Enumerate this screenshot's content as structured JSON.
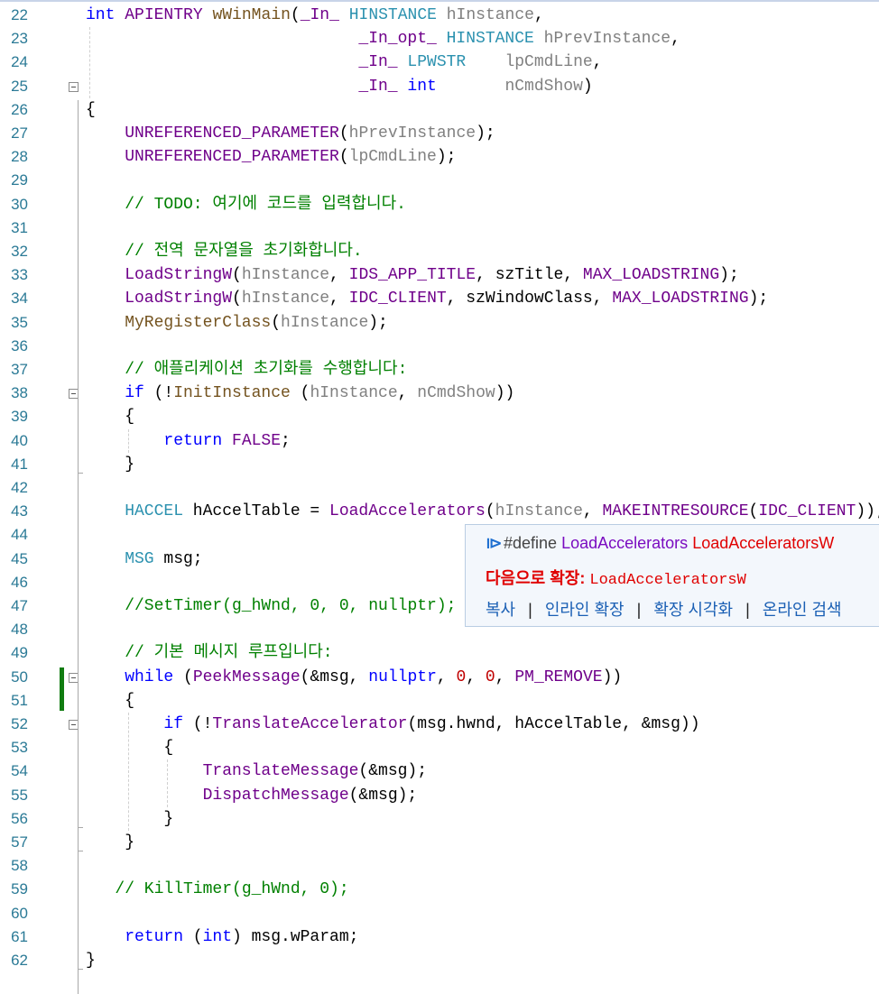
{
  "editor": {
    "lines": [
      {
        "n": "22",
        "indent": 0,
        "tokens": [
          [
            "int",
            "kw"
          ],
          [
            " "
          ],
          [
            "APIENTRY",
            "mac"
          ],
          [
            " "
          ],
          [
            "wWinMain",
            "fn"
          ],
          [
            "("
          ],
          [
            "_In_",
            "mac"
          ],
          [
            " "
          ],
          [
            "HINSTANCE",
            "type"
          ],
          [
            " "
          ],
          [
            "hInstance",
            "param"
          ],
          [
            ","
          ]
        ]
      },
      {
        "n": "23",
        "indent": 14,
        "tokens": [
          [
            "_In_opt_",
            "mac"
          ],
          [
            " "
          ],
          [
            "HINSTANCE",
            "type"
          ],
          [
            " "
          ],
          [
            "hPrevInstance",
            "param"
          ],
          [
            ","
          ]
        ]
      },
      {
        "n": "24",
        "indent": 14,
        "tokens": [
          [
            "_In_",
            "mac"
          ],
          [
            " "
          ],
          [
            "LPWSTR",
            "type"
          ],
          [
            "    "
          ],
          [
            "lpCmdLine",
            "param"
          ],
          [
            ","
          ]
        ]
      },
      {
        "n": "25",
        "indent": 14,
        "tokens": [
          [
            "_In_",
            "mac"
          ],
          [
            " "
          ],
          [
            "int",
            "kw"
          ],
          [
            "       "
          ],
          [
            "nCmdShow",
            "param"
          ],
          [
            ")"
          ]
        ]
      },
      {
        "n": "26",
        "indent": 0,
        "tokens": [
          [
            "{"
          ]
        ]
      },
      {
        "n": "27",
        "indent": 2,
        "tokens": [
          [
            "UNREFERENCED_PARAMETER",
            "mac"
          ],
          [
            "("
          ],
          [
            "hPrevInstance",
            "param"
          ],
          [
            ");"
          ]
        ]
      },
      {
        "n": "28",
        "indent": 2,
        "tokens": [
          [
            "UNREFERENCED_PARAMETER",
            "mac"
          ],
          [
            "("
          ],
          [
            "lpCmdLine",
            "param"
          ],
          [
            ");"
          ]
        ]
      },
      {
        "n": "29",
        "indent": 0,
        "tokens": []
      },
      {
        "n": "30",
        "indent": 2,
        "tokens": [
          [
            "// TODO: 여기에 코드를 입력합니다.",
            "com"
          ]
        ]
      },
      {
        "n": "31",
        "indent": 0,
        "tokens": []
      },
      {
        "n": "32",
        "indent": 2,
        "tokens": [
          [
            "// 전역 문자열을 초기화합니다.",
            "com"
          ]
        ]
      },
      {
        "n": "33",
        "indent": 2,
        "tokens": [
          [
            "LoadStringW",
            "mac"
          ],
          [
            "("
          ],
          [
            "hInstance",
            "param"
          ],
          [
            ", "
          ],
          [
            "IDS_APP_TITLE",
            "mac"
          ],
          [
            ", szTitle, "
          ],
          [
            "MAX_LOADSTRING",
            "mac"
          ],
          [
            ");"
          ]
        ]
      },
      {
        "n": "34",
        "indent": 2,
        "tokens": [
          [
            "LoadStringW",
            "mac"
          ],
          [
            "("
          ],
          [
            "hInstance",
            "param"
          ],
          [
            ", "
          ],
          [
            "IDC_CLIENT",
            "mac"
          ],
          [
            ", szWindowClass, "
          ],
          [
            "MAX_LOADSTRING",
            "mac"
          ],
          [
            ");"
          ]
        ]
      },
      {
        "n": "35",
        "indent": 2,
        "tokens": [
          [
            "MyRegisterClass",
            "fn"
          ],
          [
            "("
          ],
          [
            "hInstance",
            "param"
          ],
          [
            ");"
          ]
        ]
      },
      {
        "n": "36",
        "indent": 0,
        "tokens": []
      },
      {
        "n": "37",
        "indent": 2,
        "tokens": [
          [
            "// 애플리케이션 초기화를 수행합니다:",
            "com"
          ]
        ]
      },
      {
        "n": "38",
        "indent": 2,
        "tokens": [
          [
            "if",
            "kw"
          ],
          [
            " (!"
          ],
          [
            "InitInstance",
            "fn"
          ],
          [
            " ("
          ],
          [
            "hInstance",
            "param"
          ],
          [
            ", "
          ],
          [
            "nCmdShow",
            "param"
          ],
          [
            "))"
          ]
        ]
      },
      {
        "n": "39",
        "indent": 2,
        "tokens": [
          [
            "{"
          ]
        ]
      },
      {
        "n": "40",
        "indent": 4,
        "tokens": [
          [
            "return",
            "kw"
          ],
          [
            " "
          ],
          [
            "FALSE",
            "mac"
          ],
          [
            ";"
          ]
        ]
      },
      {
        "n": "41",
        "indent": 2,
        "tokens": [
          [
            "}"
          ]
        ]
      },
      {
        "n": "42",
        "indent": 0,
        "tokens": []
      },
      {
        "n": "43",
        "indent": 2,
        "tokens": [
          [
            "HACCEL",
            "type"
          ],
          [
            " hAccelTable = "
          ],
          [
            "LoadAccelerators",
            "mac"
          ],
          [
            "("
          ],
          [
            "hInstance",
            "param"
          ],
          [
            ", "
          ],
          [
            "MAKEINTRESOURCE",
            "mac"
          ],
          [
            "("
          ],
          [
            "IDC_CLIENT",
            "mac"
          ],
          [
            "));"
          ]
        ]
      },
      {
        "n": "44",
        "indent": 0,
        "tokens": []
      },
      {
        "n": "45",
        "indent": 2,
        "tokens": [
          [
            "MSG",
            "type"
          ],
          [
            " msg;"
          ]
        ]
      },
      {
        "n": "46",
        "indent": 0,
        "tokens": []
      },
      {
        "n": "47",
        "indent": 2,
        "tokens": [
          [
            "//SetTimer(g_hWnd, 0, 0, nullptr);",
            "com"
          ]
        ]
      },
      {
        "n": "48",
        "indent": 0,
        "tokens": []
      },
      {
        "n": "49",
        "indent": 2,
        "tokens": [
          [
            "// 기본 메시지 루프입니다:",
            "com"
          ]
        ]
      },
      {
        "n": "50",
        "indent": 2,
        "tokens": [
          [
            "while",
            "kw"
          ],
          [
            " ("
          ],
          [
            "PeekMessage",
            "mac"
          ],
          [
            "(&msg, "
          ],
          [
            "nullptr",
            "kw"
          ],
          [
            ", "
          ],
          [
            "0",
            "num"
          ],
          [
            ", "
          ],
          [
            "0",
            "num"
          ],
          [
            ", "
          ],
          [
            "PM_REMOVE",
            "mac"
          ],
          [
            "))"
          ]
        ]
      },
      {
        "n": "51",
        "indent": 2,
        "tokens": [
          [
            "{"
          ]
        ]
      },
      {
        "n": "52",
        "indent": 4,
        "tokens": [
          [
            "if",
            "kw"
          ],
          [
            " (!"
          ],
          [
            "TranslateAccelerator",
            "mac"
          ],
          [
            "(msg.hwnd, hAccelTable, &msg))"
          ]
        ]
      },
      {
        "n": "53",
        "indent": 4,
        "tokens": [
          [
            "{"
          ]
        ]
      },
      {
        "n": "54",
        "indent": 6,
        "tokens": [
          [
            "TranslateMessage",
            "mac"
          ],
          [
            "(&msg);"
          ]
        ]
      },
      {
        "n": "55",
        "indent": 6,
        "tokens": [
          [
            "DispatchMessage",
            "mac"
          ],
          [
            "(&msg);"
          ]
        ]
      },
      {
        "n": "56",
        "indent": 4,
        "tokens": [
          [
            "}"
          ]
        ]
      },
      {
        "n": "57",
        "indent": 2,
        "tokens": [
          [
            "}"
          ]
        ]
      },
      {
        "n": "58",
        "indent": 0,
        "tokens": []
      },
      {
        "n": "59",
        "indent": 1.5,
        "tokens": [
          [
            "// KillTimer(g_hWnd, 0);",
            "com"
          ]
        ]
      },
      {
        "n": "60",
        "indent": 0,
        "tokens": []
      },
      {
        "n": "61",
        "indent": 2,
        "tokens": [
          [
            "return",
            "kw"
          ],
          [
            " ("
          ],
          [
            "int",
            "kw"
          ],
          [
            ") msg.wParam;"
          ]
        ]
      },
      {
        "n": "62",
        "indent": 0,
        "tokens": [
          [
            "}"
          ]
        ]
      }
    ]
  },
  "tooltip": {
    "icon": "macro-icon",
    "define_keyword": "#define",
    "macro_name": "LoadAccelerators",
    "macro_value": "LoadAcceleratorsW",
    "expand_label": "다음으로 확장:",
    "expand_value": "LoadAcceleratorsW",
    "actions": [
      "복사",
      "인라인 확장",
      "확장 시각화",
      "온라인 검색"
    ]
  },
  "colors": {
    "keyword": "#0000ff",
    "macro": "#6f008a",
    "type": "#2b91af",
    "comment": "#008000",
    "change_bar": "#107c10"
  }
}
